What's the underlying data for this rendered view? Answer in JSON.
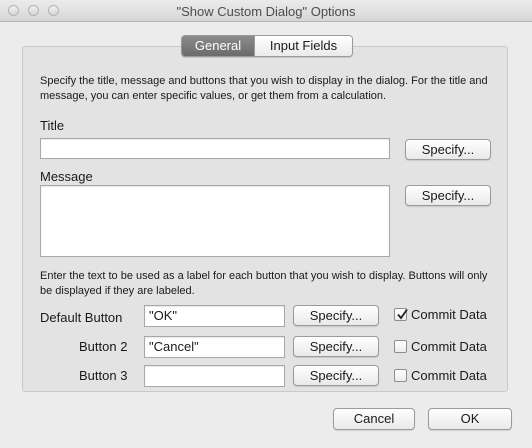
{
  "window": {
    "title": "\"Show Custom Dialog\" Options"
  },
  "tabs": [
    {
      "label": "General",
      "active": true
    },
    {
      "label": "Input Fields",
      "active": false
    }
  ],
  "general": {
    "intro": "Specify the title, message and buttons that you wish to display in the dialog. For the title and message, you can enter specific values, or get them from a calculation.",
    "title_label": "Title",
    "title_value": "",
    "message_label": "Message",
    "message_value": "",
    "specify_label": "Specify...",
    "buttons_intro": "Enter the text to be used as a label for each button that you wish to display. Buttons will only be displayed if they are labeled.",
    "commit_label": "Commit Data",
    "buttons": [
      {
        "label": "Default Button",
        "value": "\"OK\"",
        "commit": true
      },
      {
        "label": "Button 2",
        "value": "\"Cancel\"",
        "commit": false
      },
      {
        "label": "Button 3",
        "value": "",
        "commit": false
      }
    ]
  },
  "footer": {
    "cancel_label": "Cancel",
    "ok_label": "OK"
  }
}
